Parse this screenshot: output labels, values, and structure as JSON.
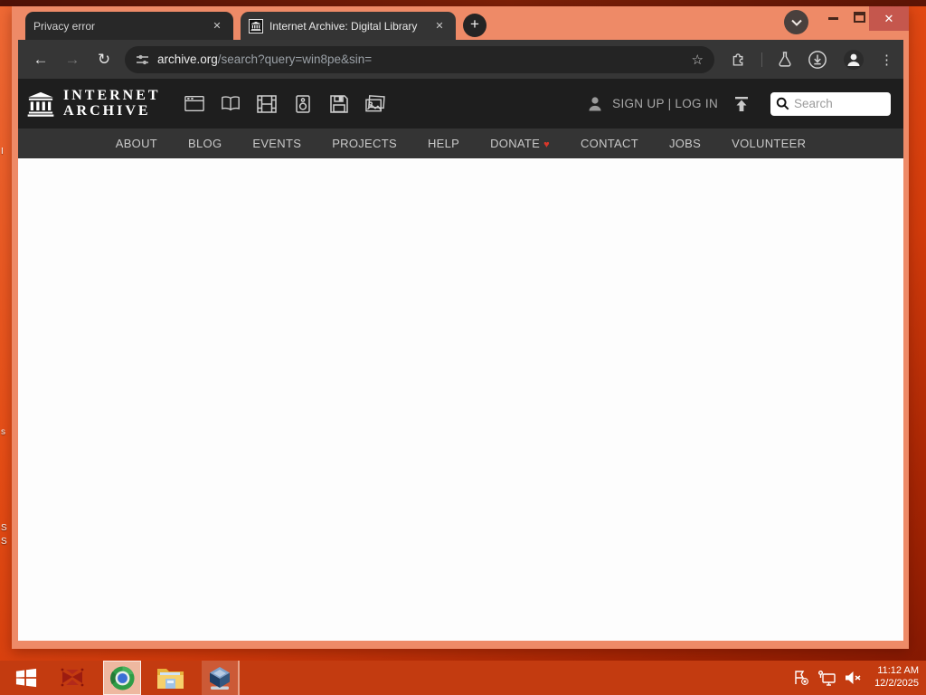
{
  "desktop": {
    "label_fragments": [
      "I",
      "s",
      "S",
      "S"
    ]
  },
  "browser": {
    "tabs": [
      {
        "title": "Privacy error",
        "close_label": "✕"
      },
      {
        "title": "Internet Archive: Digital Library",
        "close_label": "✕"
      }
    ],
    "new_tab_label": "+",
    "window_controls": {
      "close": "✕"
    },
    "toolbar": {
      "back": "←",
      "forward": "→",
      "reload": "↻",
      "bookmark_star": "☆",
      "menu_dots": "⋮",
      "url_domain": "archive.org",
      "url_path": "/search?query=win8pe&sin="
    }
  },
  "page": {
    "header": {
      "logo_line1": "INTERNET",
      "logo_line2": "ARCHIVE",
      "media_types": [
        "web",
        "texts",
        "video",
        "audio",
        "software",
        "images"
      ],
      "signup_login": "SIGN UP | LOG IN",
      "search_placeholder": "Search"
    },
    "nav": {
      "items": [
        "ABOUT",
        "BLOG",
        "EVENTS",
        "PROJECTS",
        "HELP",
        "DONATE",
        "CONTACT",
        "JOBS",
        "VOLUNTEER"
      ],
      "donate_heart": "♥"
    }
  },
  "taskbar": {
    "time": "11:12 AM",
    "date": "12/2/2025"
  },
  "colors": {
    "window_frame": "#ee8a67",
    "close_button": "#c5574d",
    "taskbar": "#c33b10",
    "donate_heart": "#d9372a",
    "accent_dark_header": "#1e1e1e"
  }
}
